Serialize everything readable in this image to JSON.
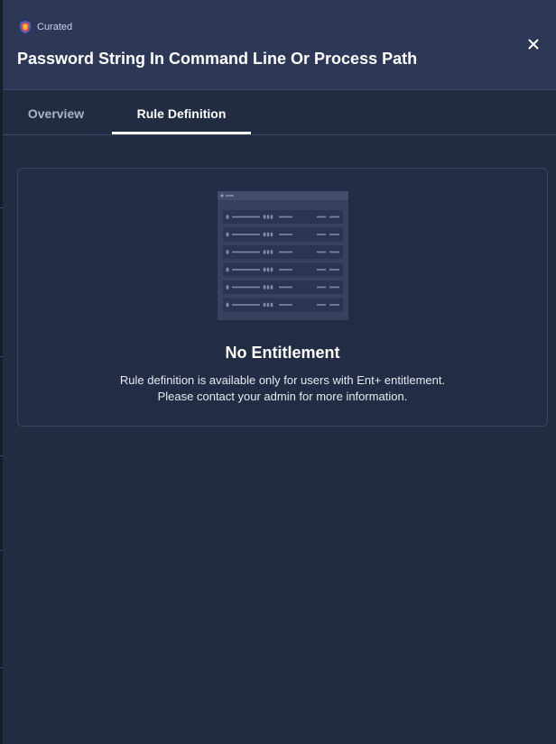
{
  "header": {
    "badge_label": "Curated",
    "badge_icon": "shield-icon",
    "title": "Password String In Command Line Or Process Path",
    "close_icon": "close-icon"
  },
  "tabs": [
    {
      "label": "Overview",
      "active": false
    },
    {
      "label": "Rule Definition",
      "active": true
    }
  ],
  "empty_state": {
    "illustration": "table-placeholder-illustration",
    "heading": "No Entitlement",
    "message_line1": "Rule definition is available only for users with Ent+ entitlement.",
    "message_line2": "Please contact your admin for more information."
  },
  "colors": {
    "background": "#212b42",
    "header_background": "#2c3856",
    "active_tab_underline": "#ffffff",
    "inactive_tab_text": "#aab4c8",
    "card_border": "#3a4762"
  }
}
